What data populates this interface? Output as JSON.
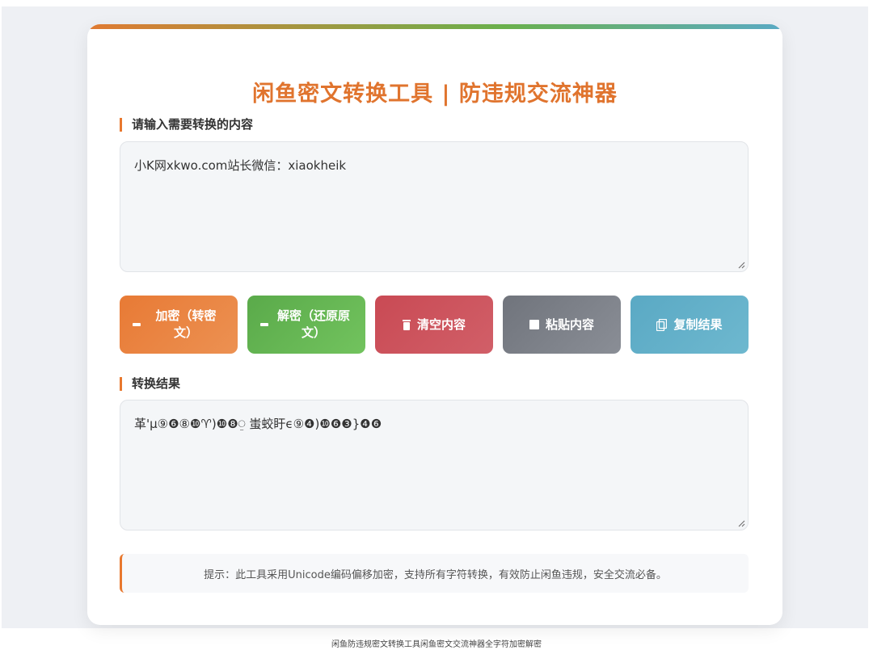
{
  "title": "闲鱼密文转换工具 | 防违规交流神器",
  "input_section": {
    "label": "请输入需要转换的内容",
    "value": "小K网xkwo.com站长微信：xiaokheik"
  },
  "buttons": {
    "encrypt": "加密（转密文）",
    "decrypt": "解密（还原原文）",
    "clear": "清空内容",
    "paste": "粘贴内容",
    "copy": "复制结果"
  },
  "output_section": {
    "label": "转换结果",
    "value": "革'µ⑨❻⑧❿♈)❿❽⍜ 蚩蛟盱ϵ⑨❹)❿❻❸}❹❻"
  },
  "tip": "提示：此工具采用Unicode编码偏移加密，支持所有字符转换，有效防止闲鱼违规，安全交流必备。",
  "caption": "闲鱼防违规密文转换工具闲鱼密文交流神器全字符加密解密",
  "colors": {
    "accent": "#e0742e",
    "encrypt": "#e87a35",
    "decrypt": "#5aaa4a",
    "clear": "#c94a54",
    "paste": "#70747c",
    "copy": "#5aa9c4"
  }
}
